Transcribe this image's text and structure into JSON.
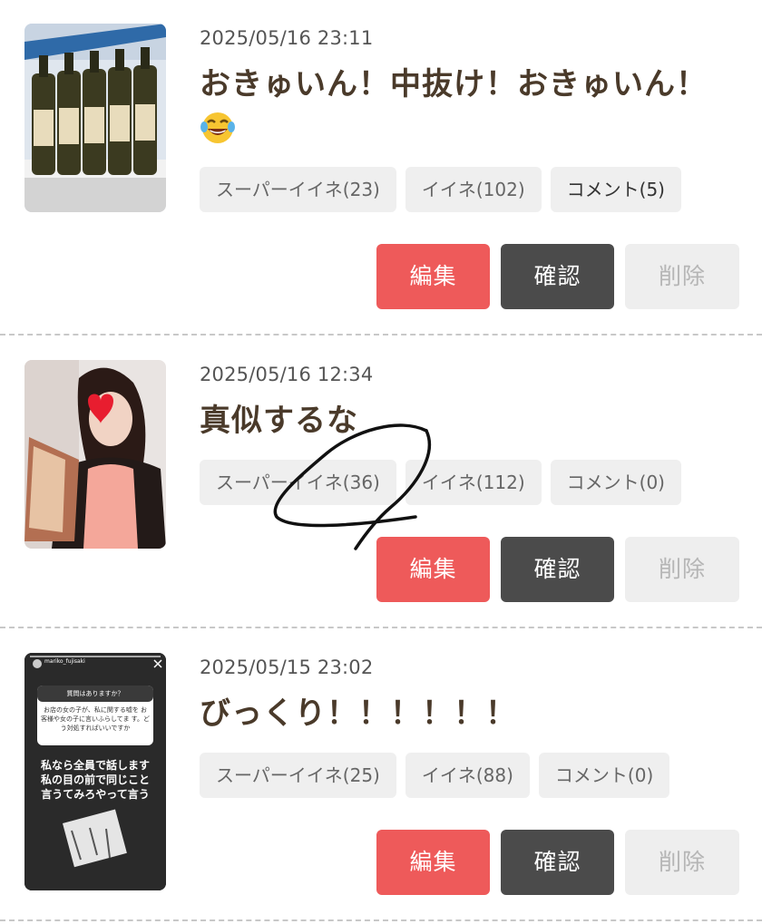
{
  "posts": [
    {
      "datetime": "2025/05/16 23:11",
      "title": "おきゅいん！中抜け！おきゅいん！",
      "emoji": "face-with-tears-of-joy-icon",
      "chips": {
        "super_like": "スーパーイイネ(23)",
        "like": "イイネ(102)",
        "comment": "コメント(5)"
      },
      "buttons": {
        "edit": "編集",
        "confirm": "確認",
        "delete": "削除"
      }
    },
    {
      "datetime": "2025/05/16 12:34",
      "title": "真似するな",
      "chips": {
        "super_like": "スーパーイイネ(36)",
        "like": "イイネ(112)",
        "comment": "コメント(0)"
      },
      "buttons": {
        "edit": "編集",
        "confirm": "確認",
        "delete": "削除"
      }
    },
    {
      "datetime": "2025/05/15 23:02",
      "title": "びっくり！！！！！！",
      "thumbnail_text": {
        "username": "mariko_fujisaki",
        "question": "質問はありますか？",
        "question_body": "お店の女の子が、私に関する嘘を お客様や女の子に言いふらしてま す。どう対処すればいいですか",
        "answer": "私なら全員で話します 私の目の前で同じこと 言うてみろやって言う"
      },
      "chips": {
        "super_like": "スーパーイイネ(25)",
        "like": "イイネ(88)",
        "comment": "コメント(0)"
      },
      "buttons": {
        "edit": "編集",
        "confirm": "確認",
        "delete": "削除"
      }
    }
  ],
  "colors": {
    "edit_button": "#ee5a5a",
    "confirm_button": "#4b4b4b",
    "delete_button": "#eeeeee",
    "title_text": "#4a3a2a",
    "chip_background": "#efefef"
  }
}
